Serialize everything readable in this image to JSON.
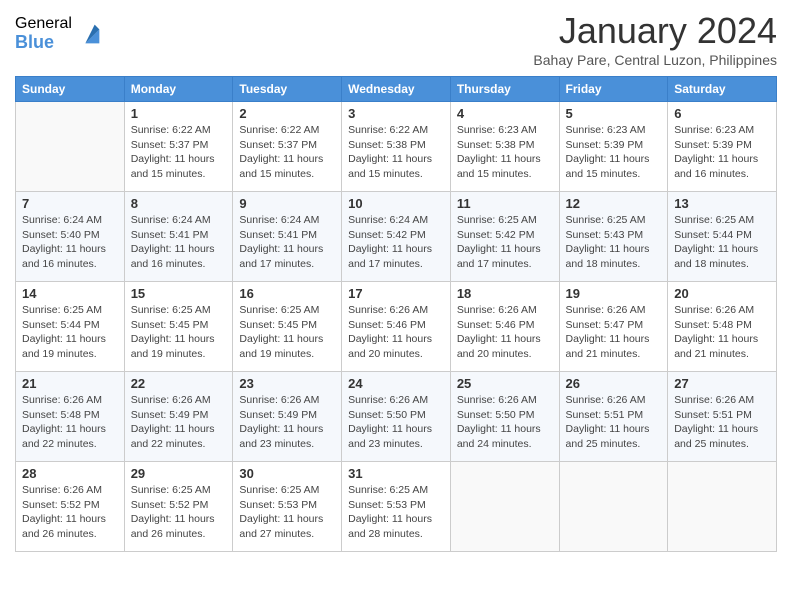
{
  "header": {
    "logo": {
      "general": "General",
      "blue": "Blue"
    },
    "title": "January 2024",
    "location": "Bahay Pare, Central Luzon, Philippines"
  },
  "weekdays": [
    "Sunday",
    "Monday",
    "Tuesday",
    "Wednesday",
    "Thursday",
    "Friday",
    "Saturday"
  ],
  "weeks": [
    [
      {
        "day": null
      },
      {
        "day": "1",
        "sunrise": "6:22 AM",
        "sunset": "5:37 PM",
        "daylight": "11 hours and 15 minutes."
      },
      {
        "day": "2",
        "sunrise": "6:22 AM",
        "sunset": "5:37 PM",
        "daylight": "11 hours and 15 minutes."
      },
      {
        "day": "3",
        "sunrise": "6:22 AM",
        "sunset": "5:38 PM",
        "daylight": "11 hours and 15 minutes."
      },
      {
        "day": "4",
        "sunrise": "6:23 AM",
        "sunset": "5:38 PM",
        "daylight": "11 hours and 15 minutes."
      },
      {
        "day": "5",
        "sunrise": "6:23 AM",
        "sunset": "5:39 PM",
        "daylight": "11 hours and 15 minutes."
      },
      {
        "day": "6",
        "sunrise": "6:23 AM",
        "sunset": "5:39 PM",
        "daylight": "11 hours and 16 minutes."
      }
    ],
    [
      {
        "day": "7",
        "sunrise": "6:24 AM",
        "sunset": "5:40 PM",
        "daylight": "11 hours and 16 minutes."
      },
      {
        "day": "8",
        "sunrise": "6:24 AM",
        "sunset": "5:41 PM",
        "daylight": "11 hours and 16 minutes."
      },
      {
        "day": "9",
        "sunrise": "6:24 AM",
        "sunset": "5:41 PM",
        "daylight": "11 hours and 17 minutes."
      },
      {
        "day": "10",
        "sunrise": "6:24 AM",
        "sunset": "5:42 PM",
        "daylight": "11 hours and 17 minutes."
      },
      {
        "day": "11",
        "sunrise": "6:25 AM",
        "sunset": "5:42 PM",
        "daylight": "11 hours and 17 minutes."
      },
      {
        "day": "12",
        "sunrise": "6:25 AM",
        "sunset": "5:43 PM",
        "daylight": "11 hours and 18 minutes."
      },
      {
        "day": "13",
        "sunrise": "6:25 AM",
        "sunset": "5:44 PM",
        "daylight": "11 hours and 18 minutes."
      }
    ],
    [
      {
        "day": "14",
        "sunrise": "6:25 AM",
        "sunset": "5:44 PM",
        "daylight": "11 hours and 19 minutes."
      },
      {
        "day": "15",
        "sunrise": "6:25 AM",
        "sunset": "5:45 PM",
        "daylight": "11 hours and 19 minutes."
      },
      {
        "day": "16",
        "sunrise": "6:25 AM",
        "sunset": "5:45 PM",
        "daylight": "11 hours and 19 minutes."
      },
      {
        "day": "17",
        "sunrise": "6:26 AM",
        "sunset": "5:46 PM",
        "daylight": "11 hours and 20 minutes."
      },
      {
        "day": "18",
        "sunrise": "6:26 AM",
        "sunset": "5:46 PM",
        "daylight": "11 hours and 20 minutes."
      },
      {
        "day": "19",
        "sunrise": "6:26 AM",
        "sunset": "5:47 PM",
        "daylight": "11 hours and 21 minutes."
      },
      {
        "day": "20",
        "sunrise": "6:26 AM",
        "sunset": "5:48 PM",
        "daylight": "11 hours and 21 minutes."
      }
    ],
    [
      {
        "day": "21",
        "sunrise": "6:26 AM",
        "sunset": "5:48 PM",
        "daylight": "11 hours and 22 minutes."
      },
      {
        "day": "22",
        "sunrise": "6:26 AM",
        "sunset": "5:49 PM",
        "daylight": "11 hours and 22 minutes."
      },
      {
        "day": "23",
        "sunrise": "6:26 AM",
        "sunset": "5:49 PM",
        "daylight": "11 hours and 23 minutes."
      },
      {
        "day": "24",
        "sunrise": "6:26 AM",
        "sunset": "5:50 PM",
        "daylight": "11 hours and 23 minutes."
      },
      {
        "day": "25",
        "sunrise": "6:26 AM",
        "sunset": "5:50 PM",
        "daylight": "11 hours and 24 minutes."
      },
      {
        "day": "26",
        "sunrise": "6:26 AM",
        "sunset": "5:51 PM",
        "daylight": "11 hours and 25 minutes."
      },
      {
        "day": "27",
        "sunrise": "6:26 AM",
        "sunset": "5:51 PM",
        "daylight": "11 hours and 25 minutes."
      }
    ],
    [
      {
        "day": "28",
        "sunrise": "6:26 AM",
        "sunset": "5:52 PM",
        "daylight": "11 hours and 26 minutes."
      },
      {
        "day": "29",
        "sunrise": "6:25 AM",
        "sunset": "5:52 PM",
        "daylight": "11 hours and 26 minutes."
      },
      {
        "day": "30",
        "sunrise": "6:25 AM",
        "sunset": "5:53 PM",
        "daylight": "11 hours and 27 minutes."
      },
      {
        "day": "31",
        "sunrise": "6:25 AM",
        "sunset": "5:53 PM",
        "daylight": "11 hours and 28 minutes."
      },
      {
        "day": null
      },
      {
        "day": null
      },
      {
        "day": null
      }
    ]
  ]
}
